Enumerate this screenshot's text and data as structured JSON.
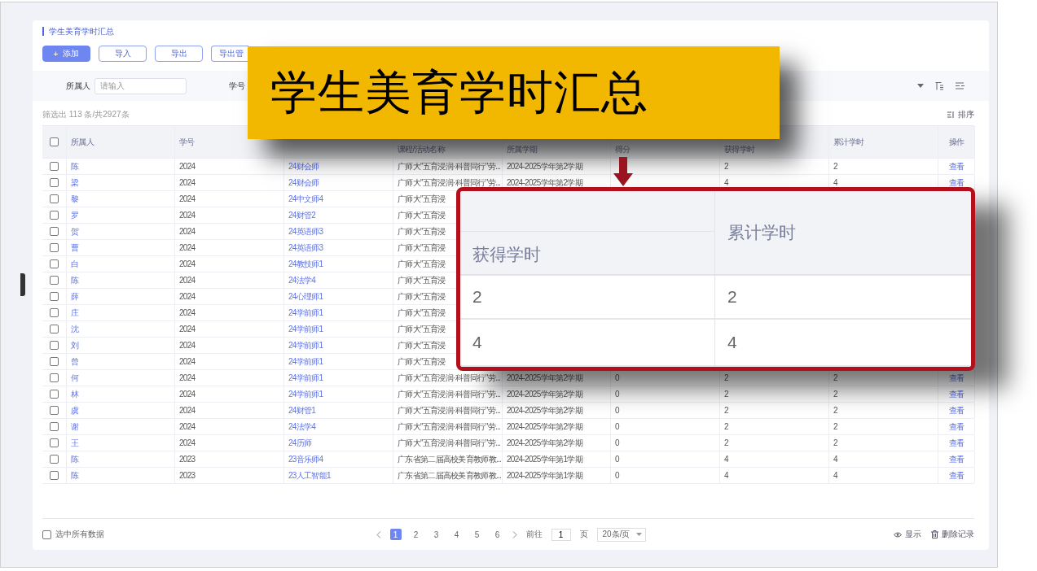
{
  "page_title": "学生美育学时汇总",
  "toolbar_buttons": [
    {
      "label": "添加",
      "icon": "+",
      "kind": "primary"
    },
    {
      "label": "导入",
      "kind": "outline"
    },
    {
      "label": "导出",
      "kind": "outline"
    },
    {
      "label": "导出管",
      "kind": "outline"
    }
  ],
  "filters": [
    {
      "label": "所属人",
      "placeholder": "请输入"
    },
    {
      "label": "学号"
    }
  ],
  "result_count": "筛选出 113 条/共2927条",
  "sort_label": "排序",
  "table": {
    "header_checked": false,
    "columns": [
      {
        "label": "所属人"
      },
      {
        "label": "学号"
      },
      {},
      {
        "label": "课程/活动名称"
      },
      {
        "label": "所属学期"
      },
      {
        "label": "得分"
      },
      {
        "label": "获得学时"
      },
      {
        "label": "累计学时"
      },
      {
        "label": "操作"
      }
    ],
    "rows": [
      {
        "checked": false,
        "name": "陈",
        "id": "2024",
        "class": "24财会师",
        "course": "广师大\"五育浸润·科普同行\"劳...",
        "term": "2024-2025学年第2学期",
        "hours": "2",
        "total": "2",
        "action": "查看"
      },
      {
        "checked": false,
        "name": "梁",
        "id": "2024",
        "class": "24财会师",
        "course": "广师大\"五育浸润·科普同行\"劳...",
        "term": "2024-2025学年第2学期",
        "hours": "4",
        "total": "4",
        "action": "查看"
      },
      {
        "checked": false,
        "name": "黎",
        "id": "2024",
        "class": "24中文师4",
        "course": "广师大\"五育浸"
      },
      {
        "checked": false,
        "name": "罗",
        "id": "2024",
        "class": "24财管2",
        "course": "广师大\"五育浸"
      },
      {
        "checked": false,
        "name": "贺",
        "id": "2024",
        "class": "24英语师3",
        "course": "广师大\"五育浸"
      },
      {
        "checked": false,
        "name": "曹",
        "id": "2024",
        "class": "24英语师3",
        "course": "广师大\"五育浸"
      },
      {
        "checked": false,
        "name": "白",
        "id": "2024",
        "class": "24教技师1",
        "course": "广师大\"五育浸"
      },
      {
        "checked": false,
        "name": "陈",
        "id": "2024",
        "class": "24法学4",
        "course": "广师大\"五育浸"
      },
      {
        "checked": false,
        "name": "薛",
        "id": "2024",
        "class": "24心理师1",
        "course": "广师大\"五育浸"
      },
      {
        "checked": false,
        "name": "庄",
        "id": "2024",
        "class": "24学前师1",
        "course": "广师大\"五育浸"
      },
      {
        "checked": false,
        "name": "沈",
        "id": "2024",
        "class": "24学前师1",
        "course": "广师大\"五育浸"
      },
      {
        "checked": false,
        "name": "刘",
        "id": "2024",
        "class": "24学前师1",
        "course": "广师大\"五育浸"
      },
      {
        "checked": false,
        "name": "曾",
        "id": "2024",
        "class": "24学前师1",
        "course": "广师大\"五育浸"
      },
      {
        "checked": false,
        "name": "何",
        "id": "2024",
        "class": "24学前师1",
        "course": "广师大\"五育浸润·科普同行\"劳...",
        "term": "2024-2025学年第2学期",
        "score": "0",
        "hours": "2",
        "total": "2",
        "action": "查看"
      },
      {
        "checked": false,
        "name": "林",
        "id": "2024",
        "class": "24学前师1",
        "course": "广师大\"五育浸润·科普同行\"劳...",
        "term": "2024-2025学年第2学期",
        "score": "0",
        "hours": "2",
        "total": "2",
        "action": "查看"
      },
      {
        "checked": false,
        "name": "虞",
        "id": "2024",
        "class": "24财管1",
        "course": "广师大\"五育浸润·科普同行\"劳...",
        "term": "2024-2025学年第2学期",
        "score": "0",
        "hours": "2",
        "total": "2",
        "action": "查看"
      },
      {
        "checked": false,
        "name": "谢",
        "id": "2024",
        "class": "24法学4",
        "course": "广师大\"五育浸润·科普同行\"劳...",
        "term": "2024-2025学年第2学期",
        "score": "0",
        "hours": "2",
        "total": "2",
        "action": "查看"
      },
      {
        "checked": false,
        "name": "王",
        "id": "2024",
        "class": "24历师",
        "course": "广师大\"五育浸润·科普同行\"劳...",
        "term": "2024-2025学年第2学期",
        "score": "0",
        "hours": "2",
        "total": "2",
        "action": "查看"
      },
      {
        "checked": false,
        "name": "陈",
        "id": "2023",
        "class": "23音乐师4",
        "course": "广东省第二届高校美育教师教...",
        "term": "2024-2025学年第1学期",
        "score": "0",
        "hours": "4",
        "total": "4",
        "action": "查看"
      },
      {
        "checked": false,
        "name": "陈",
        "id": "2023",
        "class": "23人工智能1",
        "course": "广东省第二届高校美育教师教...",
        "term": "2024-2025学年第1学期",
        "score": "0",
        "hours": "4",
        "total": "4",
        "action": "查看"
      }
    ]
  },
  "footer": {
    "select_all_label": "选中所有数据",
    "select_all_checked": false,
    "pages": [
      {
        "label": "1",
        "selected": true
      },
      {
        "label": "2",
        "selected": false
      },
      {
        "label": "3",
        "selected": false
      },
      {
        "label": "4",
        "selected": false
      },
      {
        "label": "5",
        "selected": false
      },
      {
        "label": "6",
        "selected": false
      }
    ],
    "goto_label": "前往",
    "goto_value": "1",
    "page_unit": "页",
    "page_size": "20条/页",
    "show_label": "显示",
    "delete_label": "删除记录"
  },
  "banner": {
    "text": "学生美育学时汇总"
  },
  "callout": {
    "columns": [
      {
        "label": "获得学时"
      },
      {
        "label": "累计学时"
      }
    ],
    "rows": [
      [
        "2",
        "2"
      ],
      [
        "4",
        "4"
      ]
    ]
  }
}
